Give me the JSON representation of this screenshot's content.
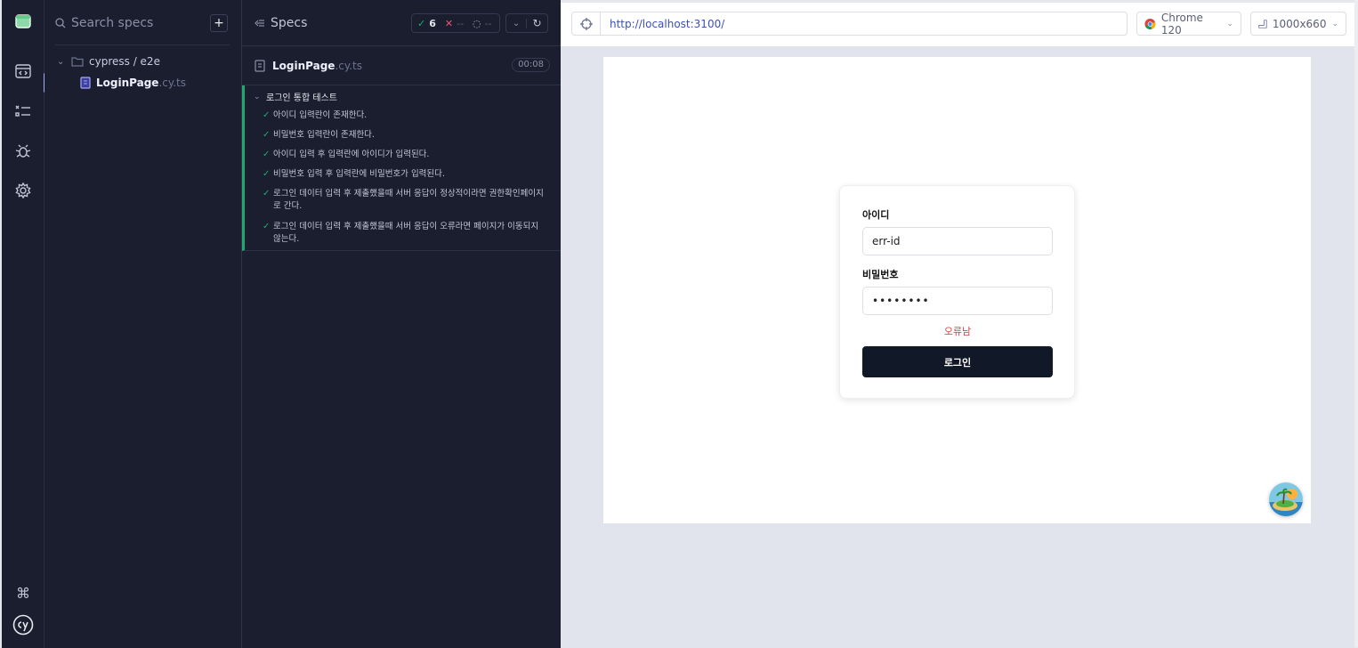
{
  "sidebar_rail": {
    "items": [
      {
        "name": "specs-nav",
        "icon": "code-window-icon"
      },
      {
        "name": "runs-nav",
        "icon": "list-icon"
      },
      {
        "name": "debug-nav",
        "icon": "bug-icon"
      },
      {
        "name": "settings-nav",
        "icon": "gear-icon"
      }
    ],
    "bottom": [
      {
        "icon": "command-key-icon"
      },
      {
        "icon": "cypress-logo-icon"
      }
    ]
  },
  "specs_panel": {
    "search_placeholder": "Search specs",
    "add_label": "+",
    "folder": "cypress / e2e",
    "file": {
      "name": "LoginPage",
      "ext": ".cy.ts"
    }
  },
  "reporter": {
    "title": "Specs",
    "stats": {
      "passed_icon": "✓",
      "passed": "6",
      "failed_icon": "✕",
      "failed": "--",
      "pending_icon": "◌",
      "pending": "--"
    },
    "spec": {
      "name": "LoginPage",
      "ext": ".cy.ts",
      "duration": "00:08"
    },
    "suite": {
      "title": "로그인 통합 테스트",
      "tests": [
        {
          "label": "아이디 입력란이 존재한다.",
          "state": "passed"
        },
        {
          "label": "비밀번호 입력란이 존재한다.",
          "state": "passed"
        },
        {
          "label": "아이디 입력 후 입력란에 아이디가 입력된다.",
          "state": "passed"
        },
        {
          "label": "비밀번호 입력 후 입력란에 비밀번호가 입력된다.",
          "state": "passed"
        },
        {
          "label": "로그인 데이터 입력 후 제출했을때 서버 응답이 정상적이라면 권한확인페이지로 간다.",
          "state": "passed"
        },
        {
          "label": "로그인 데이터 입력 후 제출했을때 서버 응답이 오류라면 페이지가 이동되지 않는다.",
          "state": "passed"
        }
      ]
    }
  },
  "preview": {
    "url": "http://localhost:3100/",
    "browser": "Chrome 120",
    "viewport": "1000x660"
  },
  "login_form": {
    "id_label": "아이디",
    "id_value": "err-id",
    "password_label": "비밀번호",
    "password_value": "••••••••",
    "error_text": "오류남",
    "submit_label": "로그인"
  },
  "colors": {
    "pass": "#1fa971",
    "fail": "#e45770",
    "accent": "#a6a9f5",
    "button": "#111827",
    "error": "#d94040"
  }
}
